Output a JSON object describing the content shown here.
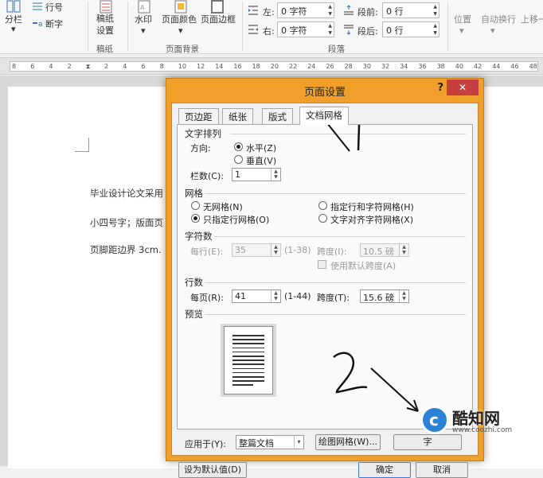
{
  "ribbon": {
    "columns": "分栏",
    "line_numbers": "行号",
    "hyphenation": "断字",
    "manuscript": "稿纸\n设置",
    "manuscript_group": "稿纸",
    "watermark": "水印",
    "page_color": "页面颜色",
    "page_border": "页面边框",
    "page_bg_group": "页面背景",
    "indent_left_label": "左:",
    "indent_left_value": "0 字符",
    "indent_right_label": "右:",
    "indent_right_value": "0 字符",
    "spacing_before_label": "段前:",
    "spacing_before_value": "0 行",
    "spacing_after_label": "段后:",
    "spacing_after_value": "0 行",
    "paragraph_group": "段落",
    "position": "位置",
    "auto_wrap": "自动换行",
    "bring_forward": "上移一"
  },
  "ruler": [
    "8",
    "6",
    "4",
    "2",
    "",
    "2",
    "4",
    "6",
    "8",
    "10",
    "12",
    "14",
    "16",
    "18",
    "20",
    "22",
    "24",
    "26",
    "28",
    "30",
    "32",
    "34",
    "36",
    "38",
    "40",
    "42",
    "44",
    "46",
    "48"
  ],
  "document": {
    "line1": "毕业设计论文采用",
    "line2": "小四号字；版面页",
    "line3": "页脚距边界 3cm."
  },
  "dialog": {
    "title": "页面设置",
    "help": "?",
    "close": "✕",
    "tabs": [
      "页边距",
      "纸张",
      "版式",
      "文档网格"
    ],
    "text_arrangement": {
      "title": "文字排列",
      "direction_label": "方向:",
      "horizontal": "水平(Z)",
      "vertical": "垂直(V)",
      "columns_label": "栏数(C):",
      "columns_value": "1"
    },
    "grid": {
      "title": "网格",
      "no_grid": "无网格(N)",
      "line_grid_only": "只指定行网格(O)",
      "char_and_line": "指定行和字符网格(H)",
      "align_to_char": "文字对齐字符网格(X)"
    },
    "characters": {
      "title": "字符数",
      "per_line_label": "每行(E):",
      "per_line_value": "35",
      "per_line_range": "(1-38)",
      "pitch_label": "跨度(I):",
      "pitch_value": "10.5 磅",
      "use_default": "使用默认跨度(A)"
    },
    "lines": {
      "title": "行数",
      "per_page_label": "每页(R):",
      "per_page_value": "41",
      "per_page_range": "(1-44)",
      "pitch_label": "跨度(T):",
      "pitch_value": "15.6 磅"
    },
    "preview_title": "预览",
    "apply_to_label": "应用于(Y):",
    "apply_to_value": "整篇文档",
    "draw_grid_button": "绘图网格(W)...",
    "font_settings_button": "字",
    "set_default_button": "设为默认值(D)",
    "ok_button": "确定",
    "cancel_button": "取消"
  },
  "watermark": {
    "logo_letter": "c",
    "title": "酷知网",
    "url": "www.coozhi.com"
  }
}
